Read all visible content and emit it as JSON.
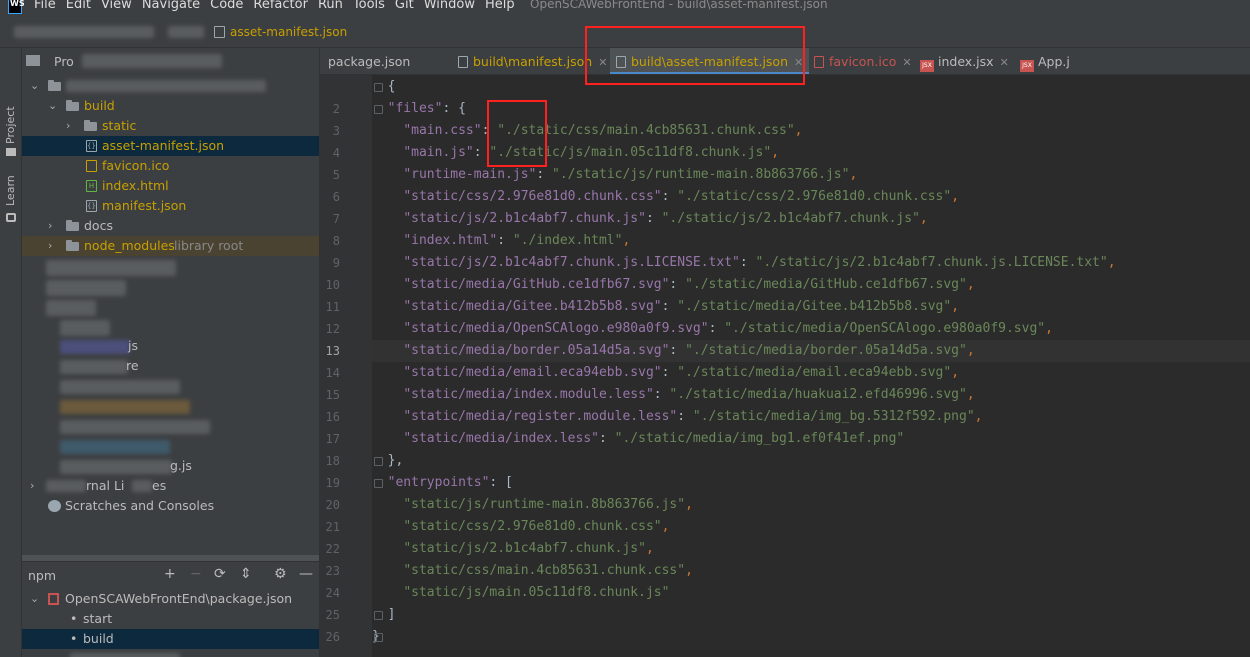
{
  "menubar": {
    "logo": "WS",
    "items": [
      "File",
      "Edit",
      "View",
      "Navigate",
      "Code",
      "Refactor",
      "Run",
      "Tools",
      "Git",
      "Window",
      "Help"
    ],
    "window_title": "OpenSCAWebFrontEnd - build\\asset-manifest.json"
  },
  "navbar": {
    "current_file": "asset-manifest.json"
  },
  "toolstrip": {
    "project": "Project",
    "learn": "Learn"
  },
  "project_panel": {
    "header": "Pro",
    "rows": [
      {
        "label": "build"
      },
      {
        "label": "static"
      },
      {
        "label": "asset-manifest.json"
      },
      {
        "label": "favicon.ico"
      },
      {
        "label": "index.html"
      },
      {
        "label": "manifest.json"
      },
      {
        "label": "docs"
      },
      {
        "label": "node_modules",
        "suffix": "library root"
      },
      {
        "label": "js"
      },
      {
        "label": "re"
      },
      {
        "label": "g.js"
      },
      {
        "label": "rnal Li",
        "suffix": "es"
      },
      {
        "label": "Scratches and Consoles"
      }
    ]
  },
  "npm_panel": {
    "title": "npm",
    "package": "OpenSCAWebFrontEnd\\package.json",
    "scripts": [
      "start",
      "build"
    ]
  },
  "tabs": [
    {
      "label": "package.json",
      "color": "#bbbbbb",
      "close": false
    },
    {
      "label": "build\\manifest.json",
      "color": "#c8a000",
      "close": true
    },
    {
      "label": "build\\asset-manifest.json",
      "color": "#c8a000",
      "close": true,
      "active": true
    },
    {
      "label": "favicon.ico",
      "color": "#c75450",
      "close": true
    },
    {
      "label": "index.jsx",
      "color": "#bbbbbb",
      "close": true
    },
    {
      "label": "App.j",
      "color": "#bbbbbb",
      "close": false
    }
  ],
  "code": {
    "current_line": 13,
    "lines": [
      {
        "n": "",
        "t": "{"
      },
      {
        "n": "2",
        "k": "files",
        "t": ": {"
      },
      {
        "n": "3",
        "k": "main.css",
        "v": "./static/css/main.4cb85631.chunk.css"
      },
      {
        "n": "4",
        "k": "main.js",
        "v": "./static/js/main.05c11df8.chunk.js"
      },
      {
        "n": "5",
        "k": "runtime-main.js",
        "v": "./static/js/runtime-main.8b863766.js"
      },
      {
        "n": "6",
        "k": "static/css/2.976e81d0.chunk.css",
        "v": "./static/css/2.976e81d0.chunk.css"
      },
      {
        "n": "7",
        "k": "static/js/2.b1c4abf7.chunk.js",
        "v": "./static/js/2.b1c4abf7.chunk.js"
      },
      {
        "n": "8",
        "k": "index.html",
        "v": "./index.html"
      },
      {
        "n": "9",
        "k": "static/js/2.b1c4abf7.chunk.js.LICENSE.txt",
        "v": "./static/js/2.b1c4abf7.chunk.js.LICENSE.txt"
      },
      {
        "n": "10",
        "k": "static/media/GitHub.ce1dfb67.svg",
        "v": "./static/media/GitHub.ce1dfb67.svg"
      },
      {
        "n": "11",
        "k": "static/media/Gitee.b412b5b8.svg",
        "v": "./static/media/Gitee.b412b5b8.svg"
      },
      {
        "n": "12",
        "k": "static/media/OpenSCAlogo.e980a0f9.svg",
        "v": "./static/media/OpenSCAlogo.e980a0f9.svg"
      },
      {
        "n": "13",
        "k": "static/media/border.05a14d5a.svg",
        "v": "./static/media/border.05a14d5a.svg"
      },
      {
        "n": "14",
        "k": "static/media/email.eca94ebb.svg",
        "v": "./static/media/email.eca94ebb.svg"
      },
      {
        "n": "15",
        "k": "static/media/index.module.less",
        "v": "./static/media/huakuai2.efd46996.svg"
      },
      {
        "n": "16",
        "k": "static/media/register.module.less",
        "v": "./static/media/img_bg.5312f592.png"
      },
      {
        "n": "17",
        "k": "static/media/index.less",
        "v": "./static/media/img_bg1.ef0f41ef.png",
        "last": true
      },
      {
        "n": "18",
        "t": "},"
      },
      {
        "n": "19",
        "k": "entrypoints",
        "t": ": ["
      },
      {
        "n": "20",
        "a": "static/js/runtime-main.8b863766.js"
      },
      {
        "n": "21",
        "a": "static/css/2.976e81d0.chunk.css"
      },
      {
        "n": "22",
        "a": "static/js/2.b1c4abf7.chunk.js"
      },
      {
        "n": "23",
        "a": "static/css/main.4cb85631.chunk.css"
      },
      {
        "n": "24",
        "a": "static/js/main.05c11df8.chunk.js",
        "last": true
      },
      {
        "n": "25",
        "t": "]"
      },
      {
        "n": "26",
        "t": "}"
      }
    ]
  },
  "colors": {
    "accent": "#4a88c7",
    "annotation": "#ff2020",
    "key": "#9876aa",
    "string": "#6a8759"
  }
}
